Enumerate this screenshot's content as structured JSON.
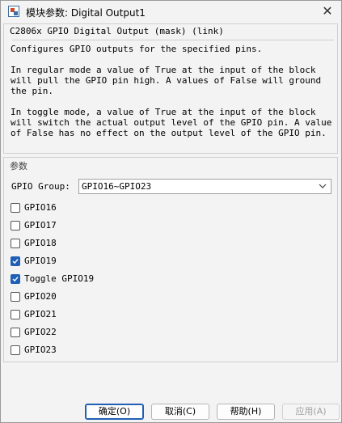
{
  "window": {
    "title": "模块参数: Digital Output1",
    "close_glyph": "✕"
  },
  "description": {
    "title": "C2806x GPIO Digital Output (mask) (link)",
    "paragraphs": [
      "Configures GPIO outputs for the specified pins.",
      "In regular mode a value of True at the input of the block will pull the GPIO pin high. A values of False will ground the pin.",
      "In toggle mode, a value of True at the input of the block will switch the actual output level of the GPIO pin. A value of False has no effect on the output level of the GPIO pin."
    ]
  },
  "parameters": {
    "legend": "参数",
    "gpio_group_label": "GPIO Group:",
    "gpio_group_value": "GPIO16~GPIO23",
    "checkboxes": [
      {
        "label": "GPIO16",
        "checked": false
      },
      {
        "label": "GPIO17",
        "checked": false
      },
      {
        "label": "GPIO18",
        "checked": false
      },
      {
        "label": "GPIO19",
        "checked": true
      },
      {
        "label": "Toggle GPIO19",
        "checked": true
      },
      {
        "label": "GPIO20",
        "checked": false
      },
      {
        "label": "GPIO21",
        "checked": false
      },
      {
        "label": "GPIO22",
        "checked": false
      },
      {
        "label": "GPIO23",
        "checked": false
      }
    ]
  },
  "buttons": {
    "ok": "确定(O)",
    "cancel": "取消(C)",
    "help": "帮助(H)",
    "apply": "应用(A)"
  },
  "colors": {
    "accent": "#1f5fb5",
    "background": "#f3f3f3"
  }
}
